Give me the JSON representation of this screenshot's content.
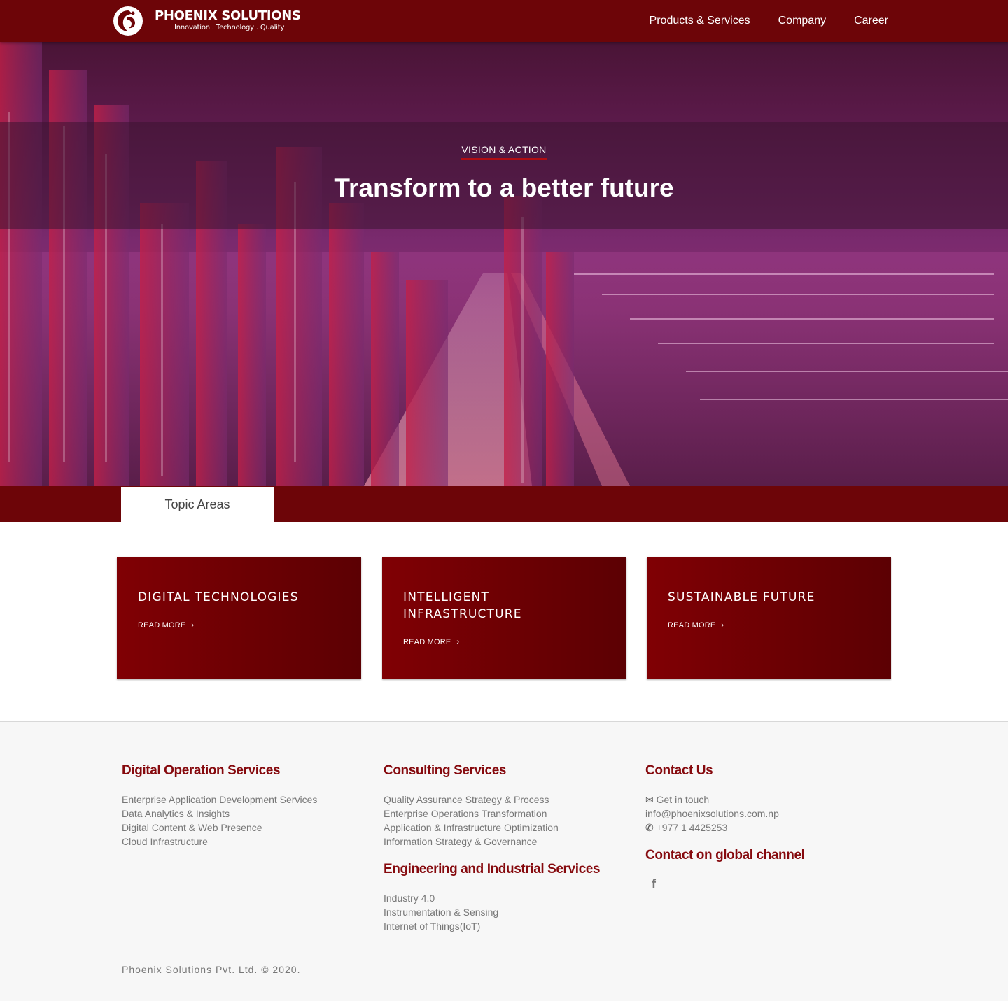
{
  "header": {
    "logo_name": "PHOENIX SOLUTIONS",
    "logo_tagline": "Innovation . Technology . Quality",
    "nav": [
      {
        "label": "Products & Services"
      },
      {
        "label": "Company"
      },
      {
        "label": "Career"
      }
    ],
    "background": "#6d0508"
  },
  "hero": {
    "kicker": "VISION & ACTION",
    "title": "Transform to a better future"
  },
  "topic_tab": {
    "label": "Topic Areas"
  },
  "cards": [
    {
      "title": "DIGITAL TECHNOLOGIES",
      "link": "READ MORE"
    },
    {
      "title": "INTELLIGENT INFRASTRUCTURE",
      "link": "READ MORE"
    },
    {
      "title": "SUSTAINABLE FUTURE",
      "link": "READ MORE"
    }
  ],
  "footer": {
    "digital_ops": {
      "heading": "Digital Operation Services",
      "items": [
        "Enterprise Application Development Services",
        "Data Analytics & Insights",
        "Digital Content & Web Presence",
        "Cloud Infrastructure"
      ]
    },
    "consulting": {
      "heading": "Consulting Services",
      "items": [
        "Quality Assurance Strategy & Process",
        "Enterprise Operations Transformation",
        "Application & Infrastructure Optimization",
        "Information Strategy & Governance"
      ]
    },
    "engineering": {
      "heading": "Engineering and Industrial Services",
      "items": [
        "Industry 4.0",
        "Instrumentation & Sensing",
        "Internet of Things(IoT)"
      ]
    },
    "contact": {
      "heading": "Contact Us",
      "get_in_touch": "Get in touch",
      "email": "info@phoenixsolutions.com.np",
      "phone": "+977 1 4425253"
    },
    "global": {
      "heading": "Contact on global channel",
      "facebook_glyph": "f"
    },
    "copyright": "Phoenix Solutions Pvt. Ltd. © 2020."
  },
  "colors": {
    "brand_red": "#6d0508",
    "heading_red": "#860a0e",
    "footer_bg": "#f7f7f7"
  }
}
